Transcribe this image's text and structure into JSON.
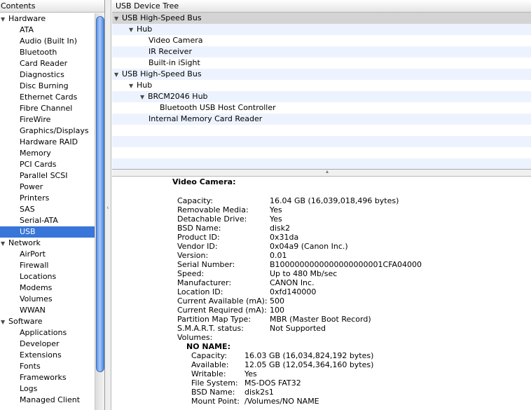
{
  "sidebar": {
    "header": "Contents",
    "groups": [
      {
        "label": "Hardware",
        "items": [
          "ATA",
          "Audio (Built In)",
          "Bluetooth",
          "Card Reader",
          "Diagnostics",
          "Disc Burning",
          "Ethernet Cards",
          "Fibre Channel",
          "FireWire",
          "Graphics/Displays",
          "Hardware RAID",
          "Memory",
          "PCI Cards",
          "Parallel SCSI",
          "Power",
          "Printers",
          "SAS",
          "Serial-ATA",
          "USB"
        ]
      },
      {
        "label": "Network",
        "items": [
          "AirPort",
          "Firewall",
          "Locations",
          "Modems",
          "Volumes",
          "WWAN"
        ]
      },
      {
        "label": "Software",
        "items": [
          "Applications",
          "Developer",
          "Extensions",
          "Fonts",
          "Frameworks",
          "Logs",
          "Managed Client"
        ]
      }
    ],
    "selected": "USB"
  },
  "tree": {
    "header": "USB Device Tree",
    "rows": [
      {
        "label": "USB High-Speed Bus",
        "level": 0,
        "expanded": true,
        "highlight": true
      },
      {
        "label": "Hub",
        "level": 1,
        "expanded": true
      },
      {
        "label": "Video Camera",
        "level": 3
      },
      {
        "label": "IR Receiver",
        "level": 3
      },
      {
        "label": "Built-in iSight",
        "level": 3
      },
      {
        "label": "USB High-Speed Bus",
        "level": 0,
        "expanded": true
      },
      {
        "label": "Hub",
        "level": 1,
        "expanded": true
      },
      {
        "label": "BRCM2046 Hub",
        "level": 2,
        "expanded": true
      },
      {
        "label": "Bluetooth USB Host Controller",
        "level": 4
      },
      {
        "label": "Internal Memory Card Reader",
        "level": 3
      },
      {
        "label": ""
      },
      {
        "label": ""
      },
      {
        "label": ""
      },
      {
        "label": ""
      }
    ]
  },
  "detail": {
    "title": "Video Camera:",
    "properties": [
      {
        "key": "Capacity:",
        "value": "16.04 GB (16,039,018,496 bytes)"
      },
      {
        "key": "Removable Media:",
        "value": "Yes"
      },
      {
        "key": "Detachable Drive:",
        "value": "Yes"
      },
      {
        "key": "BSD Name:",
        "value": "disk2"
      },
      {
        "key": "Product ID:",
        "value": "0x31da"
      },
      {
        "key": "Vendor ID:",
        "value": "0x04a9  (Canon Inc.)"
      },
      {
        "key": "Version:",
        "value": " 0.01"
      },
      {
        "key": "Serial Number:",
        "value": "B1000000000000000000001CFA04000"
      },
      {
        "key": "Speed:",
        "value": "Up to 480 Mb/sec"
      },
      {
        "key": "Manufacturer:",
        "value": "CANON Inc."
      },
      {
        "key": "Location ID:",
        "value": "0xfd140000"
      },
      {
        "key": "Current Available (mA):",
        "value": "500"
      },
      {
        "key": "Current Required (mA):",
        "value": "100"
      },
      {
        "key": "Partition Map Type:",
        "value": "MBR (Master Boot Record)"
      },
      {
        "key": "S.M.A.R.T. status:",
        "value": "Not Supported"
      },
      {
        "key": "Volumes:",
        "value": ""
      }
    ],
    "volume": {
      "name": "NO NAME:",
      "properties": [
        {
          "key": "Capacity:",
          "value": "16.03 GB (16,034,824,192 bytes)"
        },
        {
          "key": "Available:",
          "value": "12.05 GB (12,054,364,160 bytes)"
        },
        {
          "key": "Writable:",
          "value": "Yes"
        },
        {
          "key": "File System:",
          "value": "MS-DOS FAT32"
        },
        {
          "key": "BSD Name:",
          "value": "disk2s1"
        },
        {
          "key": "Mount Point:",
          "value": "/Volumes/NO NAME"
        }
      ]
    }
  },
  "colors": {
    "selection": "#3876d9",
    "stripe": "#edf3fe",
    "scroll_thumb": "#5b91e8"
  }
}
